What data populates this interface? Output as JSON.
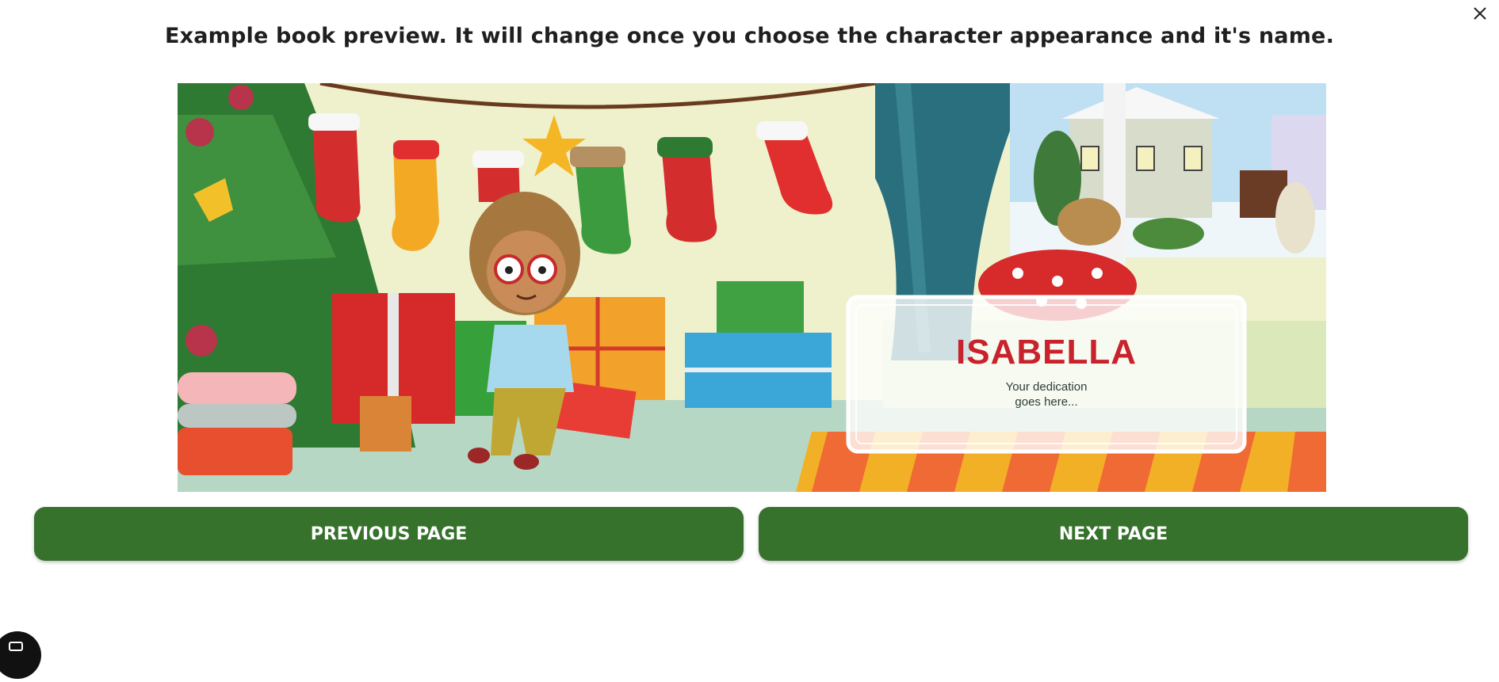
{
  "modal": {
    "title": "Example book preview. It will change once you choose the character appearance and it's name.",
    "close_icon": "close-icon"
  },
  "book_preview": {
    "character_name": "ISABELLA",
    "dedication_line1": "Your dedication",
    "dedication_line2": "goes here..."
  },
  "navigation": {
    "previous_label": "PREVIOUS PAGE",
    "next_label": "NEXT PAGE"
  },
  "colors": {
    "button_green": "#37722d",
    "name_red": "#c8222c"
  },
  "widget": {
    "icon": "chat-icon"
  }
}
